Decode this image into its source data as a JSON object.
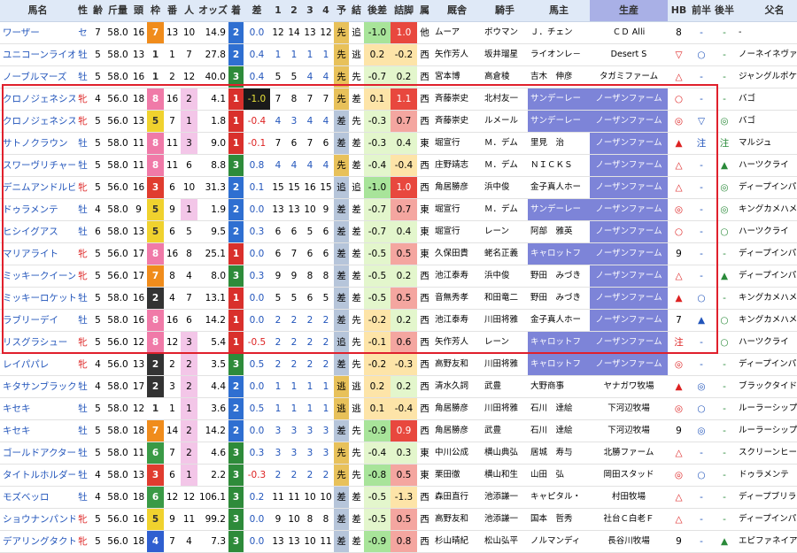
{
  "headers": [
    "馬名",
    "性",
    "齢",
    "斤量",
    "頭",
    "枠",
    "番",
    "人",
    "オッズ",
    "着",
    "差",
    "1",
    "2",
    "3",
    "4",
    "予",
    "結",
    "後差",
    "詰脚",
    "属",
    "厩舎",
    "騎手",
    "馬主",
    "生産",
    "HB",
    "前半",
    "後半",
    "父名"
  ],
  "colors": {
    "waku1": "#ffffff",
    "waku2": "#333333",
    "waku3": "#e03c2f",
    "waku4": "#2f5fd0",
    "waku5": "#f0d22e",
    "waku6": "#3a9a46",
    "waku7": "#f08c1c",
    "waku8": "#f07aa8"
  },
  "rows": [
    {
      "name": "ワーザー",
      "sex": "セ",
      "age": "7",
      "kin": "58.0",
      "tou": "16",
      "waku": "7",
      "ban": "13",
      "nin": "10",
      "odds": "14.9",
      "chaku": "2",
      "sa": "0.0",
      "p1": "12",
      "p2": "14",
      "p3": "13",
      "p4": "12",
      "yo": "先",
      "ke": "追",
      "kousa": "-1.0",
      "tsume": "1.0",
      "zoku": "他",
      "kyu": "ムーア",
      "kishu": "ボウマン",
      "banu": "Ｊ．チェン",
      "sei": "ＣＤ Alli",
      "hb": "8",
      "zen": "-",
      "kou": "-",
      "chichi": "-"
    },
    {
      "name": "ユニコーンライオン",
      "sex": "牡",
      "age": "5",
      "kin": "58.0",
      "tou": "13",
      "waku": "1",
      "ban": "1",
      "nin": "7",
      "odds": "27.8",
      "chaku": "2",
      "sa": "0.4",
      "p1": "1",
      "p2": "1",
      "p3": "1",
      "p4": "1",
      "yo": "先",
      "ke": "逃",
      "kousa": "0.2",
      "tsume": "-0.2",
      "zoku": "西",
      "kyu": "矢作芳人",
      "kishu": "坂井瑠星",
      "banu": "ライオンレ－",
      "sei": "Desert S",
      "hb": "▽",
      "zen": "○",
      "kou": "-",
      "chichi": "ノーネイネヴァー"
    },
    {
      "name": "ノーブルマーズ",
      "sex": "牡",
      "age": "5",
      "kin": "58.0",
      "tou": "16",
      "waku": "1",
      "ban": "2",
      "nin": "12",
      "odds": "40.0",
      "chaku": "3",
      "sa": "0.4",
      "p1": "5",
      "p2": "5",
      "p3": "4",
      "p4": "4",
      "yo": "先",
      "ke": "先",
      "kousa": "-0.7",
      "tsume": "0.2",
      "zoku": "西",
      "kyu": "宮本博",
      "kishu": "高倉稜",
      "banu": "吉木　伸彦",
      "sei": "タガミファーム",
      "hb": "△",
      "zen": "-",
      "kou": "-",
      "chichi": "ジャングルポケット"
    },
    {
      "name": "クロノジェネシス",
      "sex": "牝",
      "age": "4",
      "kin": "56.0",
      "tou": "18",
      "waku": "8",
      "ban": "16",
      "nin": "2",
      "odds": "4.1",
      "chaku": "1",
      "sa": "-1.0",
      "p1": "7",
      "p2": "8",
      "p3": "7",
      "p4": "7",
      "yo": "先",
      "ke": "差",
      "kousa": "0.1",
      "tsume": "1.1",
      "zoku": "西",
      "kyu": "斉藤崇史",
      "kishu": "北村友一",
      "banu": "サンデーレー",
      "sei": "ノーザンファーム",
      "hb": "○",
      "zen": "-",
      "kou": "-",
      "chichi": "バゴ"
    },
    {
      "name": "クロノジェネシス",
      "sex": "牝",
      "age": "5",
      "kin": "56.0",
      "tou": "13",
      "waku": "5",
      "ban": "7",
      "nin": "1",
      "odds": "1.8",
      "chaku": "1",
      "sa": "-0.4",
      "p1": "4",
      "p2": "3",
      "p3": "4",
      "p4": "4",
      "yo": "差",
      "ke": "先",
      "kousa": "-0.3",
      "tsume": "0.7",
      "zoku": "西",
      "kyu": "斉藤崇史",
      "kishu": "ルメール",
      "banu": "サンデーレー",
      "sei": "ノーザンファーム",
      "hb": "◎",
      "zen": "▽",
      "kou": "◎",
      "chichi": "バゴ"
    },
    {
      "name": "サトノクラウン",
      "sex": "牡",
      "age": "5",
      "kin": "58.0",
      "tou": "11",
      "waku": "8",
      "ban": "11",
      "nin": "3",
      "odds": "9.0",
      "chaku": "1",
      "sa": "-0.1",
      "p1": "7",
      "p2": "6",
      "p3": "7",
      "p4": "6",
      "yo": "差",
      "ke": "差",
      "kousa": "-0.3",
      "tsume": "0.4",
      "zoku": "東",
      "kyu": "堀宣行",
      "kishu": "Ｍ．デム",
      "banu": "里見　治",
      "sei": "ノーザンファーム",
      "hb": "▲",
      "zen": "注",
      "kou": "注",
      "chichi": "マルジュ"
    },
    {
      "name": "スワーヴリチャード",
      "sex": "牡",
      "age": "5",
      "kin": "58.0",
      "tou": "11",
      "waku": "8",
      "ban": "11",
      "nin": "6",
      "odds": "8.8",
      "chaku": "3",
      "sa": "0.8",
      "p1": "4",
      "p2": "4",
      "p3": "4",
      "p4": "4",
      "yo": "先",
      "ke": "差",
      "kousa": "-0.4",
      "tsume": "-0.4",
      "zoku": "西",
      "kyu": "庄野靖志",
      "kishu": "Ｍ．デム",
      "banu": "ＮＩＣＫＳ",
      "sei": "ノーザンファーム",
      "hb": "△",
      "zen": "-",
      "kou": "▲",
      "chichi": "ハーツクライ"
    },
    {
      "name": "デニムアンドルビー",
      "sex": "牝",
      "age": "5",
      "kin": "56.0",
      "tou": "16",
      "waku": "3",
      "ban": "6",
      "nin": "10",
      "odds": "31.3",
      "chaku": "2",
      "sa": "0.1",
      "p1": "15",
      "p2": "15",
      "p3": "16",
      "p4": "15",
      "yo": "追",
      "ke": "追",
      "kousa": "-1.0",
      "tsume": "1.0",
      "zoku": "西",
      "kyu": "角居勝彦",
      "kishu": "浜中俊",
      "banu": "金子真人ホー",
      "sei": "ノーザンファーム",
      "hb": "△",
      "zen": "-",
      "kou": "◎",
      "chichi": "ディープインパクト"
    },
    {
      "name": "ドゥラメンテ",
      "sex": "牡",
      "age": "4",
      "kin": "58.0",
      "tou": "9",
      "waku": "5",
      "ban": "9",
      "nin": "1",
      "odds": "1.9",
      "chaku": "2",
      "sa": "0.0",
      "p1": "13",
      "p2": "13",
      "p3": "10",
      "p4": "9",
      "yo": "差",
      "ke": "差",
      "kousa": "-0.7",
      "tsume": "0.7",
      "zoku": "東",
      "kyu": "堀宣行",
      "kishu": "Ｍ．デム",
      "banu": "サンデーレー",
      "sei": "ノーザンファーム",
      "hb": "◎",
      "zen": "-",
      "kou": "◎",
      "chichi": "キングカメハメハ"
    },
    {
      "name": "ヒシイグアス",
      "sex": "牡",
      "age": "6",
      "kin": "58.0",
      "tou": "13",
      "waku": "5",
      "ban": "6",
      "nin": "5",
      "odds": "9.5",
      "chaku": "2",
      "sa": "0.3",
      "p1": "6",
      "p2": "6",
      "p3": "5",
      "p4": "6",
      "yo": "差",
      "ke": "差",
      "kousa": "-0.7",
      "tsume": "0.4",
      "zoku": "東",
      "kyu": "堀宣行",
      "kishu": "レーン",
      "banu": "阿部　雅英",
      "sei": "ノーザンファーム",
      "hb": "○",
      "zen": "-",
      "kou": "○",
      "chichi": "ハーツクライ"
    },
    {
      "name": "マリアライト",
      "sex": "牝",
      "age": "5",
      "kin": "56.0",
      "tou": "17",
      "waku": "8",
      "ban": "16",
      "nin": "8",
      "odds": "25.1",
      "chaku": "1",
      "sa": "0.0",
      "p1": "6",
      "p2": "7",
      "p3": "6",
      "p4": "6",
      "yo": "差",
      "ke": "差",
      "kousa": "-0.5",
      "tsume": "0.5",
      "zoku": "東",
      "kyu": "久保田貴",
      "kishu": "蛯名正義",
      "banu": "キャロットフ",
      "sei": "ノーザンファーム",
      "hb": "9",
      "zen": "-",
      "kou": "-",
      "chichi": "ディープインパクト"
    },
    {
      "name": "ミッキークイーン",
      "sex": "牝",
      "age": "5",
      "kin": "56.0",
      "tou": "17",
      "waku": "7",
      "ban": "8",
      "nin": "4",
      "odds": "8.0",
      "chaku": "3",
      "sa": "0.3",
      "p1": "9",
      "p2": "9",
      "p3": "8",
      "p4": "8",
      "yo": "差",
      "ke": "差",
      "kousa": "-0.5",
      "tsume": "0.2",
      "zoku": "西",
      "kyu": "池江泰寿",
      "kishu": "浜中俊",
      "banu": "野田　みづき",
      "sei": "ノーザンファーム",
      "hb": "△",
      "zen": "-",
      "kou": "▲",
      "chichi": "ディープインパクト"
    },
    {
      "name": "ミッキーロケット",
      "sex": "牡",
      "age": "5",
      "kin": "58.0",
      "tou": "16",
      "waku": "2",
      "ban": "4",
      "nin": "7",
      "odds": "13.1",
      "chaku": "1",
      "sa": "0.0",
      "p1": "5",
      "p2": "5",
      "p3": "6",
      "p4": "5",
      "yo": "差",
      "ke": "差",
      "kousa": "-0.5",
      "tsume": "0.5",
      "zoku": "西",
      "kyu": "音無秀孝",
      "kishu": "和田竜二",
      "banu": "野田　みづき",
      "sei": "ノーザンファーム",
      "hb": "▲",
      "zen": "○",
      "kou": "-",
      "chichi": "キングカメハメハ"
    },
    {
      "name": "ラブリーデイ",
      "sex": "牡",
      "age": "5",
      "kin": "58.0",
      "tou": "16",
      "waku": "8",
      "ban": "16",
      "nin": "6",
      "odds": "14.2",
      "chaku": "1",
      "sa": "0.0",
      "p1": "2",
      "p2": "2",
      "p3": "2",
      "p4": "2",
      "yo": "差",
      "ke": "先",
      "kousa": "-0.2",
      "tsume": "0.2",
      "zoku": "西",
      "kyu": "池江泰寿",
      "kishu": "川田将雅",
      "banu": "金子真人ホー",
      "sei": "ノーザンファーム",
      "hb": "7",
      "zen": "▲",
      "kou": "○",
      "chichi": "キングカメハメハ"
    },
    {
      "name": "リスグラシュー",
      "sex": "牝",
      "age": "5",
      "kin": "56.0",
      "tou": "12",
      "waku": "8",
      "ban": "12",
      "nin": "3",
      "odds": "5.4",
      "chaku": "1",
      "sa": "-0.5",
      "p1": "2",
      "p2": "2",
      "p3": "2",
      "p4": "2",
      "yo": "追",
      "ke": "先",
      "kousa": "-0.1",
      "tsume": "0.6",
      "zoku": "西",
      "kyu": "矢作芳人",
      "kishu": "レーン",
      "banu": "キャロットフ",
      "sei": "ノーザンファーム",
      "hb": "注",
      "zen": "-",
      "kou": "○",
      "chichi": "ハーツクライ"
    },
    {
      "name": "レイパパレ",
      "sex": "牝",
      "age": "4",
      "kin": "56.0",
      "tou": "13",
      "waku": "2",
      "ban": "2",
      "nin": "2",
      "odds": "3.5",
      "chaku": "3",
      "sa": "0.5",
      "p1": "2",
      "p2": "2",
      "p3": "2",
      "p4": "2",
      "yo": "差",
      "ke": "先",
      "kousa": "-0.2",
      "tsume": "-0.3",
      "zoku": "西",
      "kyu": "高野友和",
      "kishu": "川田将雅",
      "banu": "キャロットフ",
      "sei": "ノーザンファーム",
      "hb": "◎",
      "zen": "-",
      "kou": "-",
      "chichi": "ディープインパクト"
    },
    {
      "name": "キタサンブラック",
      "sex": "牡",
      "age": "4",
      "kin": "58.0",
      "tou": "17",
      "waku": "2",
      "ban": "3",
      "nin": "2",
      "odds": "4.4",
      "chaku": "2",
      "sa": "0.0",
      "p1": "1",
      "p2": "1",
      "p3": "1",
      "p4": "1",
      "yo": "逃",
      "ke": "逃",
      "kousa": "0.2",
      "tsume": "0.2",
      "zoku": "西",
      "kyu": "清水久詞",
      "kishu": "武豊",
      "banu": "大野商事",
      "sei": "ヤナガワ牧場",
      "hb": "▲",
      "zen": "◎",
      "kou": "-",
      "chichi": "ブラックタイド"
    },
    {
      "name": "キセキ",
      "sex": "牡",
      "age": "5",
      "kin": "58.0",
      "tou": "12",
      "waku": "1",
      "ban": "1",
      "nin": "1",
      "odds": "3.6",
      "chaku": "2",
      "sa": "0.5",
      "p1": "1",
      "p2": "1",
      "p3": "1",
      "p4": "1",
      "yo": "逃",
      "ke": "逃",
      "kousa": "0.1",
      "tsume": "-0.4",
      "zoku": "西",
      "kyu": "角居勝彦",
      "kishu": "川田将雅",
      "banu": "石川　達絵",
      "sei": "下河辺牧場",
      "hb": "◎",
      "zen": "○",
      "kou": "-",
      "chichi": "ルーラーシップ"
    },
    {
      "name": "キセキ",
      "sex": "牡",
      "age": "5",
      "kin": "58.0",
      "tou": "18",
      "waku": "7",
      "ban": "14",
      "nin": "2",
      "odds": "14.2",
      "chaku": "2",
      "sa": "0.0",
      "p1": "3",
      "p2": "3",
      "p3": "3",
      "p4": "3",
      "yo": "差",
      "ke": "先",
      "kousa": "-0.9",
      "tsume": "0.9",
      "zoku": "西",
      "kyu": "角居勝彦",
      "kishu": "武豊",
      "banu": "石川　達絵",
      "sei": "下河辺牧場",
      "hb": "9",
      "zen": "◎",
      "kou": "-",
      "chichi": "ルーラーシップ"
    },
    {
      "name": "ゴールドアクター",
      "sex": "牡",
      "age": "5",
      "kin": "58.0",
      "tou": "11",
      "waku": "6",
      "ban": "7",
      "nin": "2",
      "odds": "4.6",
      "chaku": "3",
      "sa": "0.3",
      "p1": "3",
      "p2": "3",
      "p3": "3",
      "p4": "3",
      "yo": "先",
      "ke": "先",
      "kousa": "-0.4",
      "tsume": "0.3",
      "zoku": "東",
      "kyu": "中川公成",
      "kishu": "横山典弘",
      "banu": "居城　寿与",
      "sei": "北勝ファーム",
      "hb": "△",
      "zen": "-",
      "kou": "-",
      "chichi": "スクリーンヒーロー"
    },
    {
      "name": "タイトルホルダー",
      "sex": "牡",
      "age": "4",
      "kin": "58.0",
      "tou": "13",
      "waku": "3",
      "ban": "6",
      "nin": "1",
      "odds": "2.2",
      "chaku": "3",
      "sa": "-0.3",
      "p1": "2",
      "p2": "2",
      "p3": "2",
      "p4": "2",
      "yo": "先",
      "ke": "先",
      "kousa": "-0.8",
      "tsume": "0.5",
      "zoku": "東",
      "kyu": "栗田徹",
      "kishu": "横山和生",
      "banu": "山田　弘",
      "sei": "岡田スタッド",
      "hb": "◎",
      "zen": "○",
      "kou": "-",
      "chichi": "ドゥラメンテ"
    },
    {
      "name": "モズベッロ",
      "sex": "牡",
      "age": "4",
      "kin": "58.0",
      "tou": "18",
      "waku": "6",
      "ban": "12",
      "nin": "12",
      "odds": "106.1",
      "chaku": "3",
      "sa": "0.2",
      "p1": "11",
      "p2": "11",
      "p3": "10",
      "p4": "10",
      "yo": "差",
      "ke": "差",
      "kousa": "-0.5",
      "tsume": "-1.3",
      "zoku": "西",
      "kyu": "森田直行",
      "kishu": "池添謙一",
      "banu": "キャピタル・",
      "sei": "村田牧場",
      "hb": "△",
      "zen": "-",
      "kou": "-",
      "chichi": "ディープブリランテ"
    },
    {
      "name": "ショウナンパンドラ",
      "sex": "牝",
      "age": "5",
      "kin": "56.0",
      "tou": "16",
      "waku": "5",
      "ban": "9",
      "nin": "11",
      "odds": "99.2",
      "chaku": "3",
      "sa": "0.0",
      "p1": "9",
      "p2": "10",
      "p3": "8",
      "p4": "8",
      "yo": "差",
      "ke": "差",
      "kousa": "-0.5",
      "tsume": "0.5",
      "zoku": "西",
      "kyu": "高野友和",
      "kishu": "池添謙一",
      "banu": "国本　哲秀",
      "sei": "社台Ｃ白老Ｆ",
      "hb": "△",
      "zen": "-",
      "kou": "-",
      "chichi": "ディープインパクト"
    },
    {
      "name": "デアリングタクト",
      "sex": "牝",
      "age": "5",
      "kin": "56.0",
      "tou": "18",
      "waku": "4",
      "ban": "7",
      "nin": "4",
      "odds": "7.3",
      "chaku": "3",
      "sa": "0.0",
      "p1": "13",
      "p2": "13",
      "p3": "10",
      "p4": "11",
      "yo": "差",
      "ke": "差",
      "kousa": "-0.9",
      "tsume": "0.8",
      "zoku": "西",
      "kyu": "杉山晴紀",
      "kishu": "松山弘平",
      "banu": "ノルマンディ",
      "sei": "長谷川牧場",
      "hb": "9",
      "zen": "-",
      "kou": "▲",
      "chichi": "エピファネイア"
    }
  ]
}
